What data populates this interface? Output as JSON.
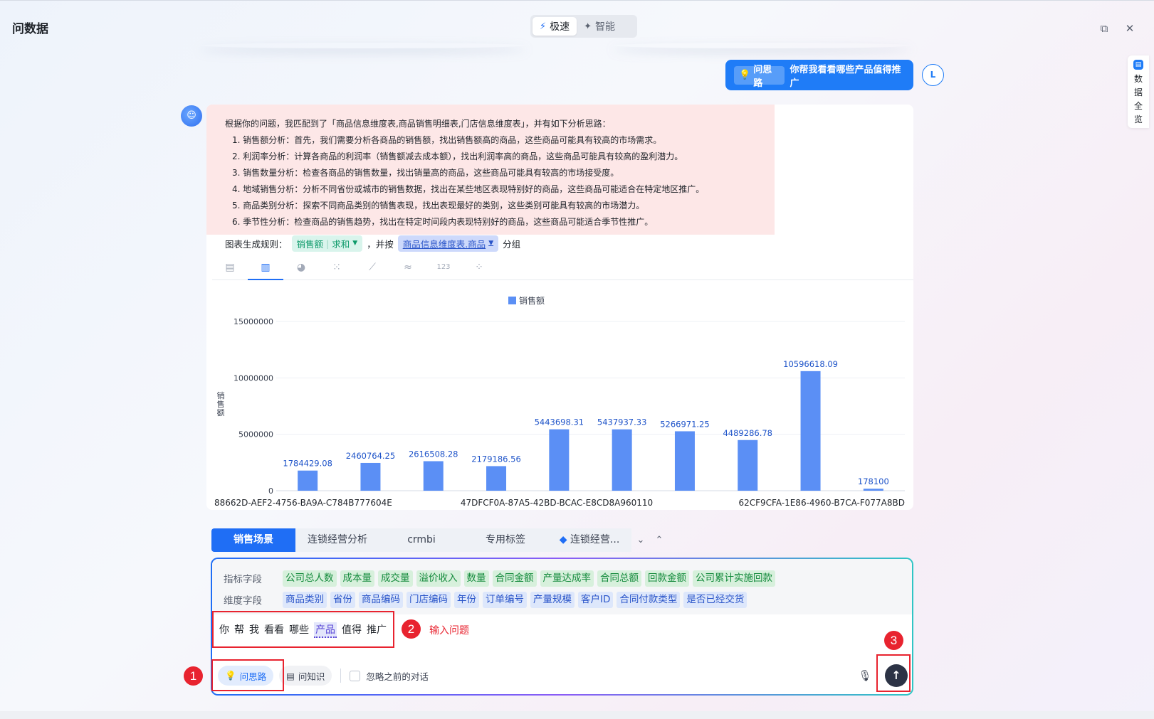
{
  "app": {
    "title": "问数据"
  },
  "mode": {
    "fast": "极速",
    "smart": "智能"
  },
  "user_message": {
    "tag": "问思路",
    "text": "你帮我看看哪些产品值得推广",
    "avatar": "L"
  },
  "side_panel": {
    "label": "数据全览"
  },
  "analysis": {
    "intro": "根据你的问题，我匹配到了「商品信息维度表,商品销售明细表,门店信息维度表」，并有如下分析思路：",
    "steps": [
      "1. 销售额分析：首先，我们需要分析各商品的销售额，找出销售额高的商品，这些商品可能具有较高的市场需求。",
      "2. 利润率分析：计算各商品的利润率（销售额减去成本额），找出利润率高的商品，这些商品可能具有较高的盈利潜力。",
      "3. 销售数量分析：检查各商品的销售数量，找出销量高的商品，这些商品可能具有较高的市场接受度。",
      "4. 地域销售分析：分析不同省份或城市的销售数据，找出在某些地区表现特别好的商品，这些商品可能适合在特定地区推广。",
      "5. 商品类别分析：探索不同商品类别的销售表现，找出表现最好的类别，这些类别可能具有较高的市场潜力。",
      "6. 季节性分析：检查商品的销售趋势，找出在特定时间段内表现特别好的商品，这些商品可能适合季节性推广。"
    ]
  },
  "rule": {
    "prefix": "图表生成规则：",
    "metric": "销售额",
    "agg": "求和",
    "mid": "，并按",
    "dimension": "商品信息维度表.商品",
    "suffix": "分组"
  },
  "chart_tabs": [
    {
      "icon": "table-icon",
      "glyph": "▤"
    },
    {
      "icon": "bar-chart-icon",
      "glyph": "▥"
    },
    {
      "icon": "pie-chart-icon",
      "glyph": "◕"
    },
    {
      "icon": "dot-chart-icon",
      "glyph": "⁙"
    },
    {
      "icon": "line-chart-icon",
      "glyph": "⟋"
    },
    {
      "icon": "area-chart-icon",
      "glyph": "≈"
    },
    {
      "icon": "number-icon",
      "glyph": "123"
    },
    {
      "icon": "scatter-icon",
      "glyph": "⁘"
    }
  ],
  "chart_data": {
    "type": "bar",
    "legend": "销售额",
    "ylabel": "销售额",
    "ylim": [
      0,
      15000000
    ],
    "yticks": [
      "15000000",
      "10000000",
      "5000000",
      "0"
    ],
    "categories": [
      "88662D-AEF2-4756-BA9A-C784B777604E",
      "",
      "",
      "",
      "47DFCF0A-87A5-42BD-BCAC-E8CD8A960110",
      "",
      "",
      "",
      "62CF9CFA-1E86-4960-B7CA-F077A8BD",
      ""
    ],
    "x_tick_labels": [
      "88662D-AEF2-4756-BA9A-C784B777604E",
      "47DFCF0A-87A5-42BD-BCAC-E8CD8A960110",
      "62CF9CFA-1E86-4960-B7CA-F077A8BD"
    ],
    "values": [
      1784429.08,
      2460764.25,
      2616508.28,
      2179186.56,
      5443698.31,
      5437937.33,
      5266971.25,
      4489286.78,
      10596618.09,
      178100
    ],
    "labels": [
      "1784429.08",
      "2460764.25",
      "2616508.28",
      "2179186.56",
      "5443698.31",
      "5437937.33",
      "5266971.25",
      "4489286.78",
      "10596618.09",
      "178100"
    ],
    "color": "#5b8ff5",
    "label_color": "#1f54c9"
  },
  "scene_tabs": {
    "items": [
      "销售场景",
      "连锁经营分析",
      "crmbi",
      "专用标签",
      "连锁经营..."
    ],
    "more": "⌄",
    "collapse": "⌃"
  },
  "fields": {
    "metric_label": "指标字段",
    "metrics": [
      "公司总人数",
      "成本量",
      "成交量",
      "溢价收入",
      "数量",
      "合同金额",
      "产量达成率",
      "合同总额",
      "回款金额",
      "公司累计实施回款"
    ],
    "dimension_label": "维度字段",
    "dimensions": [
      "商品类别",
      "省份",
      "商品编码",
      "门店编码",
      "年份",
      "订单编号",
      "产量规模",
      "客户ID",
      "合同付款类型",
      "是否已经交货"
    ]
  },
  "question": {
    "tokens": [
      "你",
      "帮",
      "我",
      "看看",
      "哪些"
    ],
    "highlight": "产品",
    "tail": [
      "值得",
      "推广"
    ]
  },
  "input_bar": {
    "think": "问思路",
    "knowledge": "问知识",
    "ignore": "忽略之前的对话"
  },
  "annotations": {
    "one": "1",
    "two": "2",
    "two_text": "输入问题",
    "three": "3"
  },
  "colors": {
    "accent": "#1f6ef5",
    "annotation": "#e8232f",
    "analysis_bg": "#fde7e7"
  }
}
